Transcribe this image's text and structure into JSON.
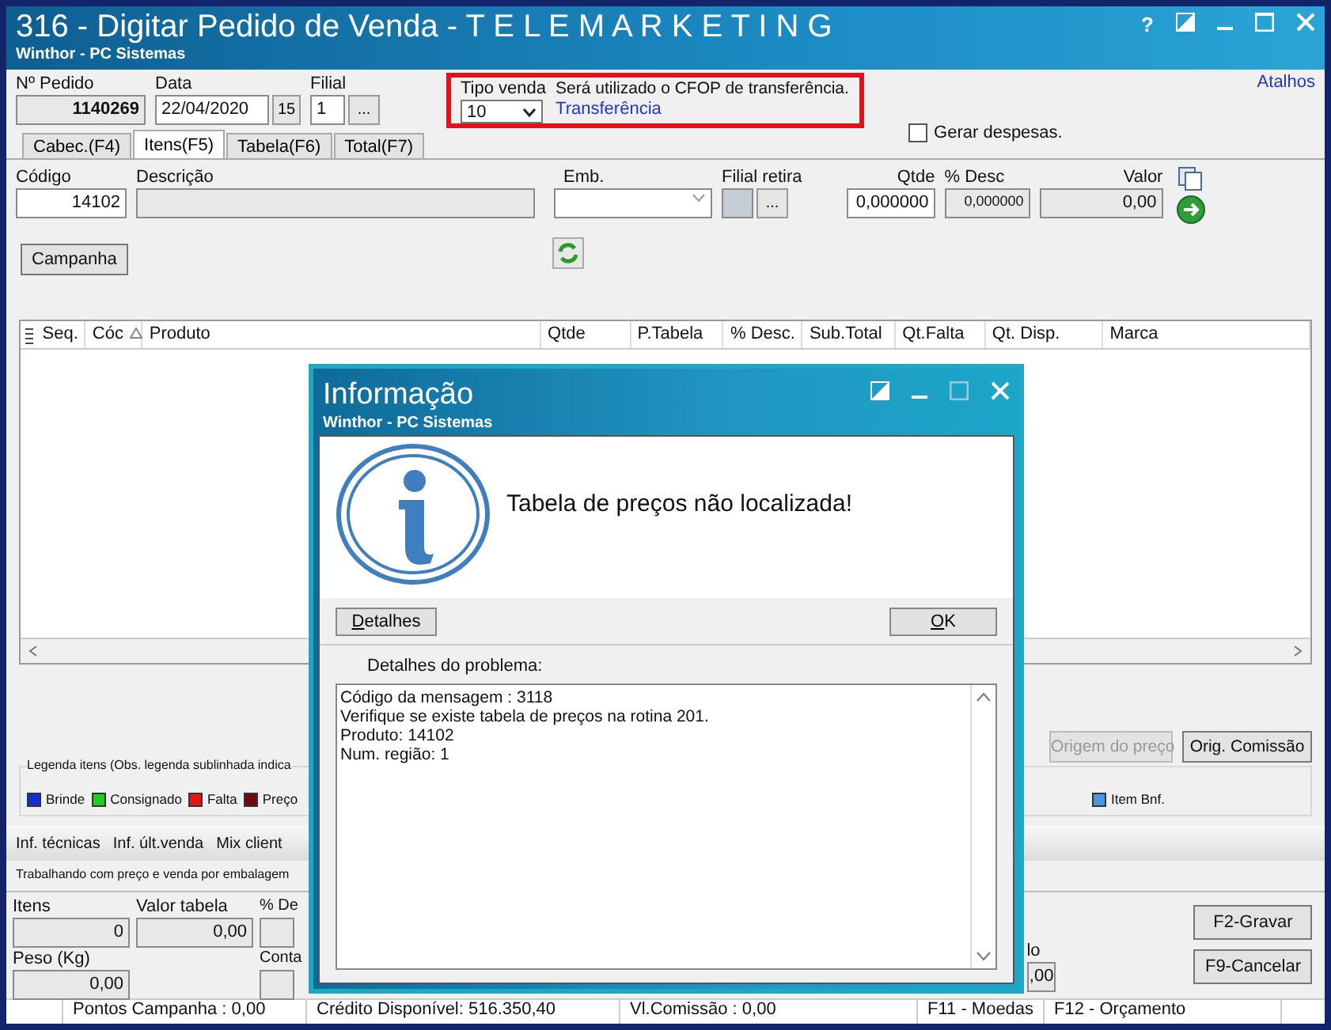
{
  "window": {
    "title": "316 - Digitar Pedido de Venda - T E L E M A R K E T I N G",
    "subtitle": "Winthor - PC Sistemas",
    "help": "?"
  },
  "header": {
    "pedido_label": "Nº Pedido",
    "pedido": "1140269",
    "data_label": "Data",
    "data": "22/04/2020",
    "calendar_day": "15",
    "filial_label": "Filial",
    "filial": "1",
    "browse": "...",
    "tipo_venda_label": "Tipo venda",
    "tipo_venda": "10",
    "cfop_note": "Será utilizado o CFOP de transferência.",
    "tipo_link": "Transferência",
    "atalhos": "Atalhos"
  },
  "tabs": [
    {
      "label": "Cabec.(F4)",
      "selected": false
    },
    {
      "label": "Itens(F5)",
      "selected": true
    },
    {
      "label": "Tabela(F6)",
      "selected": false
    },
    {
      "label": "Total(F7)",
      "selected": false
    }
  ],
  "gerar_despesas": {
    "label": "Gerar despesas.",
    "checked": false
  },
  "item": {
    "codigo_label": "Código",
    "codigo": "14102",
    "descricao_label": "Descrição",
    "emb_label": "Emb.",
    "filial_retira_label": "Filial retira",
    "filial_retira_button": "...",
    "qtde_label": "Qtde",
    "desc_label": "% Desc",
    "valor_label": "Valor",
    "qtde": "0,000000",
    "desc": "0,000000",
    "valor": "0,00",
    "campanha": "Campanha"
  },
  "grid": {
    "columns": [
      "Seq.",
      "Cóc",
      "Produto",
      "Qtde",
      "P.Tabela",
      "% Desc.",
      "Sub.Total",
      "Qt.Falta",
      "Qt. Disp.",
      "Marca"
    ]
  },
  "price_buttons": [
    {
      "label": "Origem do preço",
      "disabled": true
    },
    {
      "label": "Orig. Comissão",
      "disabled": false
    }
  ],
  "legend": {
    "title": "Legenda itens (Obs. legenda sublinhada indica",
    "items": [
      {
        "label": "Brinde",
        "color": "#1430d0"
      },
      {
        "label": "Consignado",
        "color": "#22cc22"
      },
      {
        "label": "Falta",
        "color": "#e01818"
      },
      {
        "label": "Preço",
        "color": "#6e0c0c"
      },
      {
        "label": "Item Bnf.",
        "color": "#4a96e0"
      }
    ]
  },
  "info_tabs": [
    "Inf. técnicas",
    "Inf. últ.venda",
    "Mix client"
  ],
  "embalagem_note": "Trabalhando com preço e venda por embalagem",
  "totals": {
    "itens_label": "Itens",
    "itens": "0",
    "valor_tabela_label": "Valor tabela",
    "valor_tabela": "0,00",
    "desc_label": "% De",
    "peso_label": "Peso (Kg)",
    "peso": "0,00",
    "conta_label": "Conta",
    "right_label": "lo",
    "right_value": ",00"
  },
  "actions": [
    "F2-Gravar",
    "F9-Cancelar"
  ],
  "status_bar": [
    "Pontos Campanha : 0,00",
    "Crédito Disponível: 516.350,40",
    "Vl.Comissão : 0,00",
    "F11 - Moedas",
    "F12 - Orçamento"
  ],
  "dialog": {
    "title": "Informação",
    "subtitle": "Winthor - PC Sistemas",
    "message": "Tabela de preços não localizada!",
    "details_button": "Detalhes",
    "ok_button": "OK",
    "details_label": "Detalhes do problema:",
    "details_lines": [
      "Código da mensagem : 3118",
      "Verifique se existe tabela de preços na rotina 201.",
      "Produto: 14102",
      "Num. região: 1"
    ]
  }
}
